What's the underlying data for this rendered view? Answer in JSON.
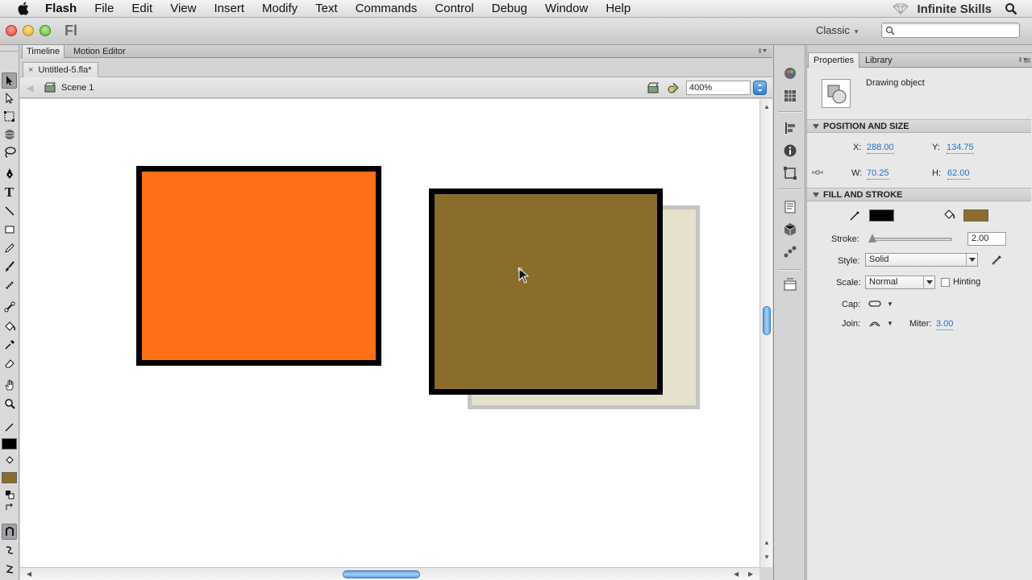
{
  "menubar": {
    "app": "Flash",
    "items": [
      "File",
      "Edit",
      "View",
      "Insert",
      "Modify",
      "Text",
      "Commands",
      "Control",
      "Debug",
      "Window",
      "Help"
    ],
    "brand": "Infinite Skills"
  },
  "appbar": {
    "logo": "Fl",
    "workspace": "Classic",
    "search_placeholder": ""
  },
  "timeline_tabs": [
    "Timeline",
    "Motion Editor"
  ],
  "document": {
    "tab": "Untitled-5.fla*",
    "close": "×"
  },
  "editbar": {
    "scene": "Scene 1",
    "zoom": "400%"
  },
  "stage": {
    "colors": {
      "orange_fill": "#ff6f16",
      "brown_fill": "#8a6d2a",
      "stroke": "#000000",
      "ghost_fill": "#e6e0cd"
    }
  },
  "toolbar": {
    "stroke_color": "#000000",
    "fill_color": "#8a6d2a"
  },
  "properties": {
    "tabs": [
      "Properties",
      "Library"
    ],
    "object_type": "Drawing object",
    "position_size": {
      "title": "POSITION AND SIZE",
      "x_label": "X:",
      "x": "288.00",
      "y_label": "Y:",
      "y": "134.75",
      "w_label": "W:",
      "w": "70.25",
      "h_label": "H:",
      "h": "62.00"
    },
    "fill_stroke": {
      "title": "FILL AND STROKE",
      "stroke_color": "#000000",
      "fill_color": "#8a6d2a",
      "stroke_label": "Stroke:",
      "stroke_value": "2.00",
      "stroke_slider_fraction": 0.02,
      "style_label": "Style:",
      "style": "Solid",
      "scale_label": "Scale:",
      "scale": "Normal",
      "hinting": "Hinting",
      "cap_label": "Cap:",
      "join_label": "Join:",
      "miter_label": "Miter:",
      "miter": "3.00"
    }
  }
}
